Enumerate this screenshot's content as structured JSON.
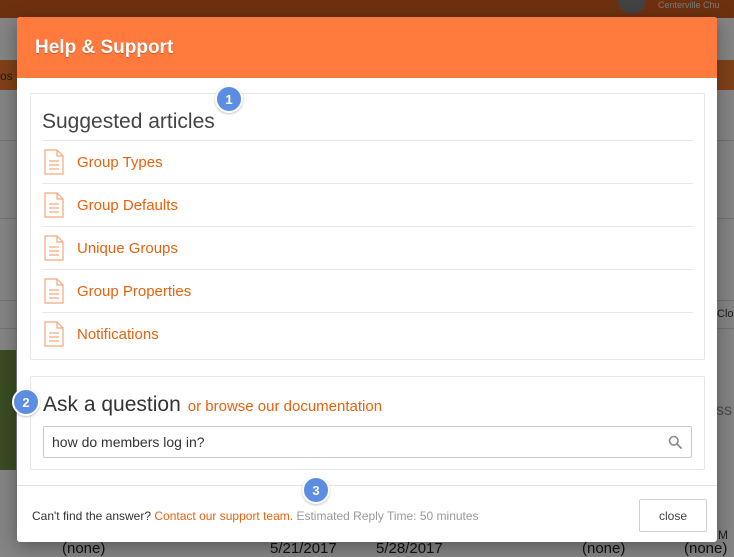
{
  "background": {
    "org_name": "Centerville Chu",
    "left_fragment": "os",
    "right_fragment_1": "Clo",
    "right_fragment_2": "ss",
    "right_fragment_3": "M",
    "bottom_cells": [
      "(none)",
      "5/21/2017",
      "5/28/2017",
      "(none)",
      "(none)"
    ]
  },
  "modal": {
    "title": "Help & Support",
    "colors": {
      "header": "#ff7a3c",
      "link": "#e8620d",
      "badge": "#5b8ee2"
    }
  },
  "articles": {
    "heading": "Suggested articles",
    "items": [
      {
        "label": "Group Types",
        "icon": "document-icon"
      },
      {
        "label": "Group Defaults",
        "icon": "document-icon"
      },
      {
        "label": "Unique Groups",
        "icon": "document-icon"
      },
      {
        "label": "Group Properties",
        "icon": "document-icon"
      },
      {
        "label": "Notifications",
        "icon": "document-icon"
      }
    ]
  },
  "question": {
    "heading": "Ask a question",
    "browse_link": "or browse our documentation",
    "search_value": "how do members log in?",
    "search_icon": "search-icon"
  },
  "footer": {
    "prompt": "Can't find the answer?",
    "contact_link": "Contact our support team.",
    "reply_time": "Estimated Reply Time: 50 minutes",
    "close_label": "close"
  },
  "badges": [
    "1",
    "2",
    "3"
  ]
}
